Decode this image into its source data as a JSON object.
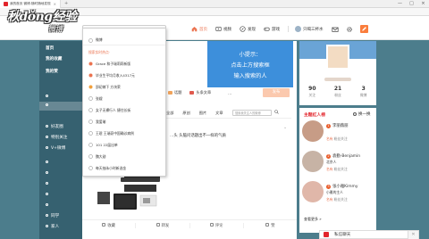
{
  "browser": {
    "tab_title": "我的首页 微博-随时随地发现",
    "close": "×",
    "new_tab": "+",
    "min": "—",
    "max": "□",
    "win_close": "×"
  },
  "logo": {
    "text": "秋dǒng经验",
    "sub": "微博"
  },
  "search": {
    "placeholder": "王珉 王瑞豪中国确诊病例"
  },
  "nav": {
    "items": [
      "首页",
      "视频",
      "发现",
      "游戏"
    ],
    "username": "只喝三杯水"
  },
  "sidebar": {
    "items": [
      "首页",
      "我的收藏",
      "我的赞",
      "",
      "",
      "好友圈",
      "特别关注",
      "V+微博",
      "",
      "",
      "",
      "",
      "",
      "同学",
      "家人"
    ]
  },
  "hint": {
    "line1": "小提示：",
    "line2": "点击上方搜索框",
    "line3": "输入搜索的人"
  },
  "compose": {
    "publish_label": "发布",
    "actions": [
      "话题",
      "头条文章"
    ],
    "more": "...",
    "icons_colors": [
      "#f0a35b",
      "#e05a4e"
    ]
  },
  "feed": {
    "tabs": [
      "全部",
      "原创",
      "图片",
      "文章"
    ],
    "search_placeholder": "搜索我关注人的微博",
    "caret": "⌄",
    "text": "…头 头脑问话题出不一样的气质"
  },
  "footer": {
    "actions": [
      "收藏",
      "转发",
      "评论",
      "赞"
    ]
  },
  "profile": {
    "stats": [
      {
        "num": "90",
        "label": "关注"
      },
      {
        "num": "21",
        "label": "粉丝"
      },
      {
        "num": "3",
        "label": "微博"
      }
    ]
  },
  "hot": {
    "title": "主题红人榜",
    "next": "换一换",
    "items": [
      {
        "rank": "1",
        "name": "李丽薇丽",
        "sub": "",
        "fans": "名有",
        "fans_suffix": "粉丝关注",
        "avatar_color": "#c79c86"
      },
      {
        "rank": "2",
        "name": "袁勤-Benjamin",
        "sub": "北京人",
        "fans": "名有",
        "fans_suffix": "粉丝关注",
        "avatar_color": "#c7b3a5"
      },
      {
        "rank": "3",
        "name": "张小雅Kimmy",
        "sub": "小雅的主人",
        "fans": "名有",
        "fans_suffix": "粉丝关注",
        "avatar_color": "#e0b7a9"
      }
    ],
    "more": "查看更多 »"
  },
  "chat": {
    "label": "私信聊天",
    "close": "✕"
  },
  "suggest": {
    "top": "微博",
    "header": "搜索实时热点·",
    "rows": [
      {
        "n": "",
        "text": "Grace 和子瑞莉莉新版",
        "kind": "mag"
      },
      {
        "n": "",
        "text": "毕业生平均月收入4317元",
        "kind": "mag"
      },
      {
        "n": "",
        "text": "邵初嫁下 方块荣",
        "kind": "mag"
      },
      {
        "n": "",
        "text": "张嫂",
        "kind": "mag"
      },
      {
        "n": "",
        "text": "女子无裸行人 捷住长街",
        "kind": "mag"
      },
      {
        "n": "",
        "text": "我爱瑜",
        "kind": "mag"
      },
      {
        "n": "",
        "text": "王珉 王瑞豪中国确诊病例",
        "kind": "mag"
      },
      {
        "n": "",
        "text": "101 22届出单",
        "kind": "mag"
      },
      {
        "n": "",
        "text": "魏大勋",
        "kind": "mag"
      },
      {
        "n": "",
        "text": "每天抽永小时新选金",
        "kind": "mag"
      }
    ]
  }
}
